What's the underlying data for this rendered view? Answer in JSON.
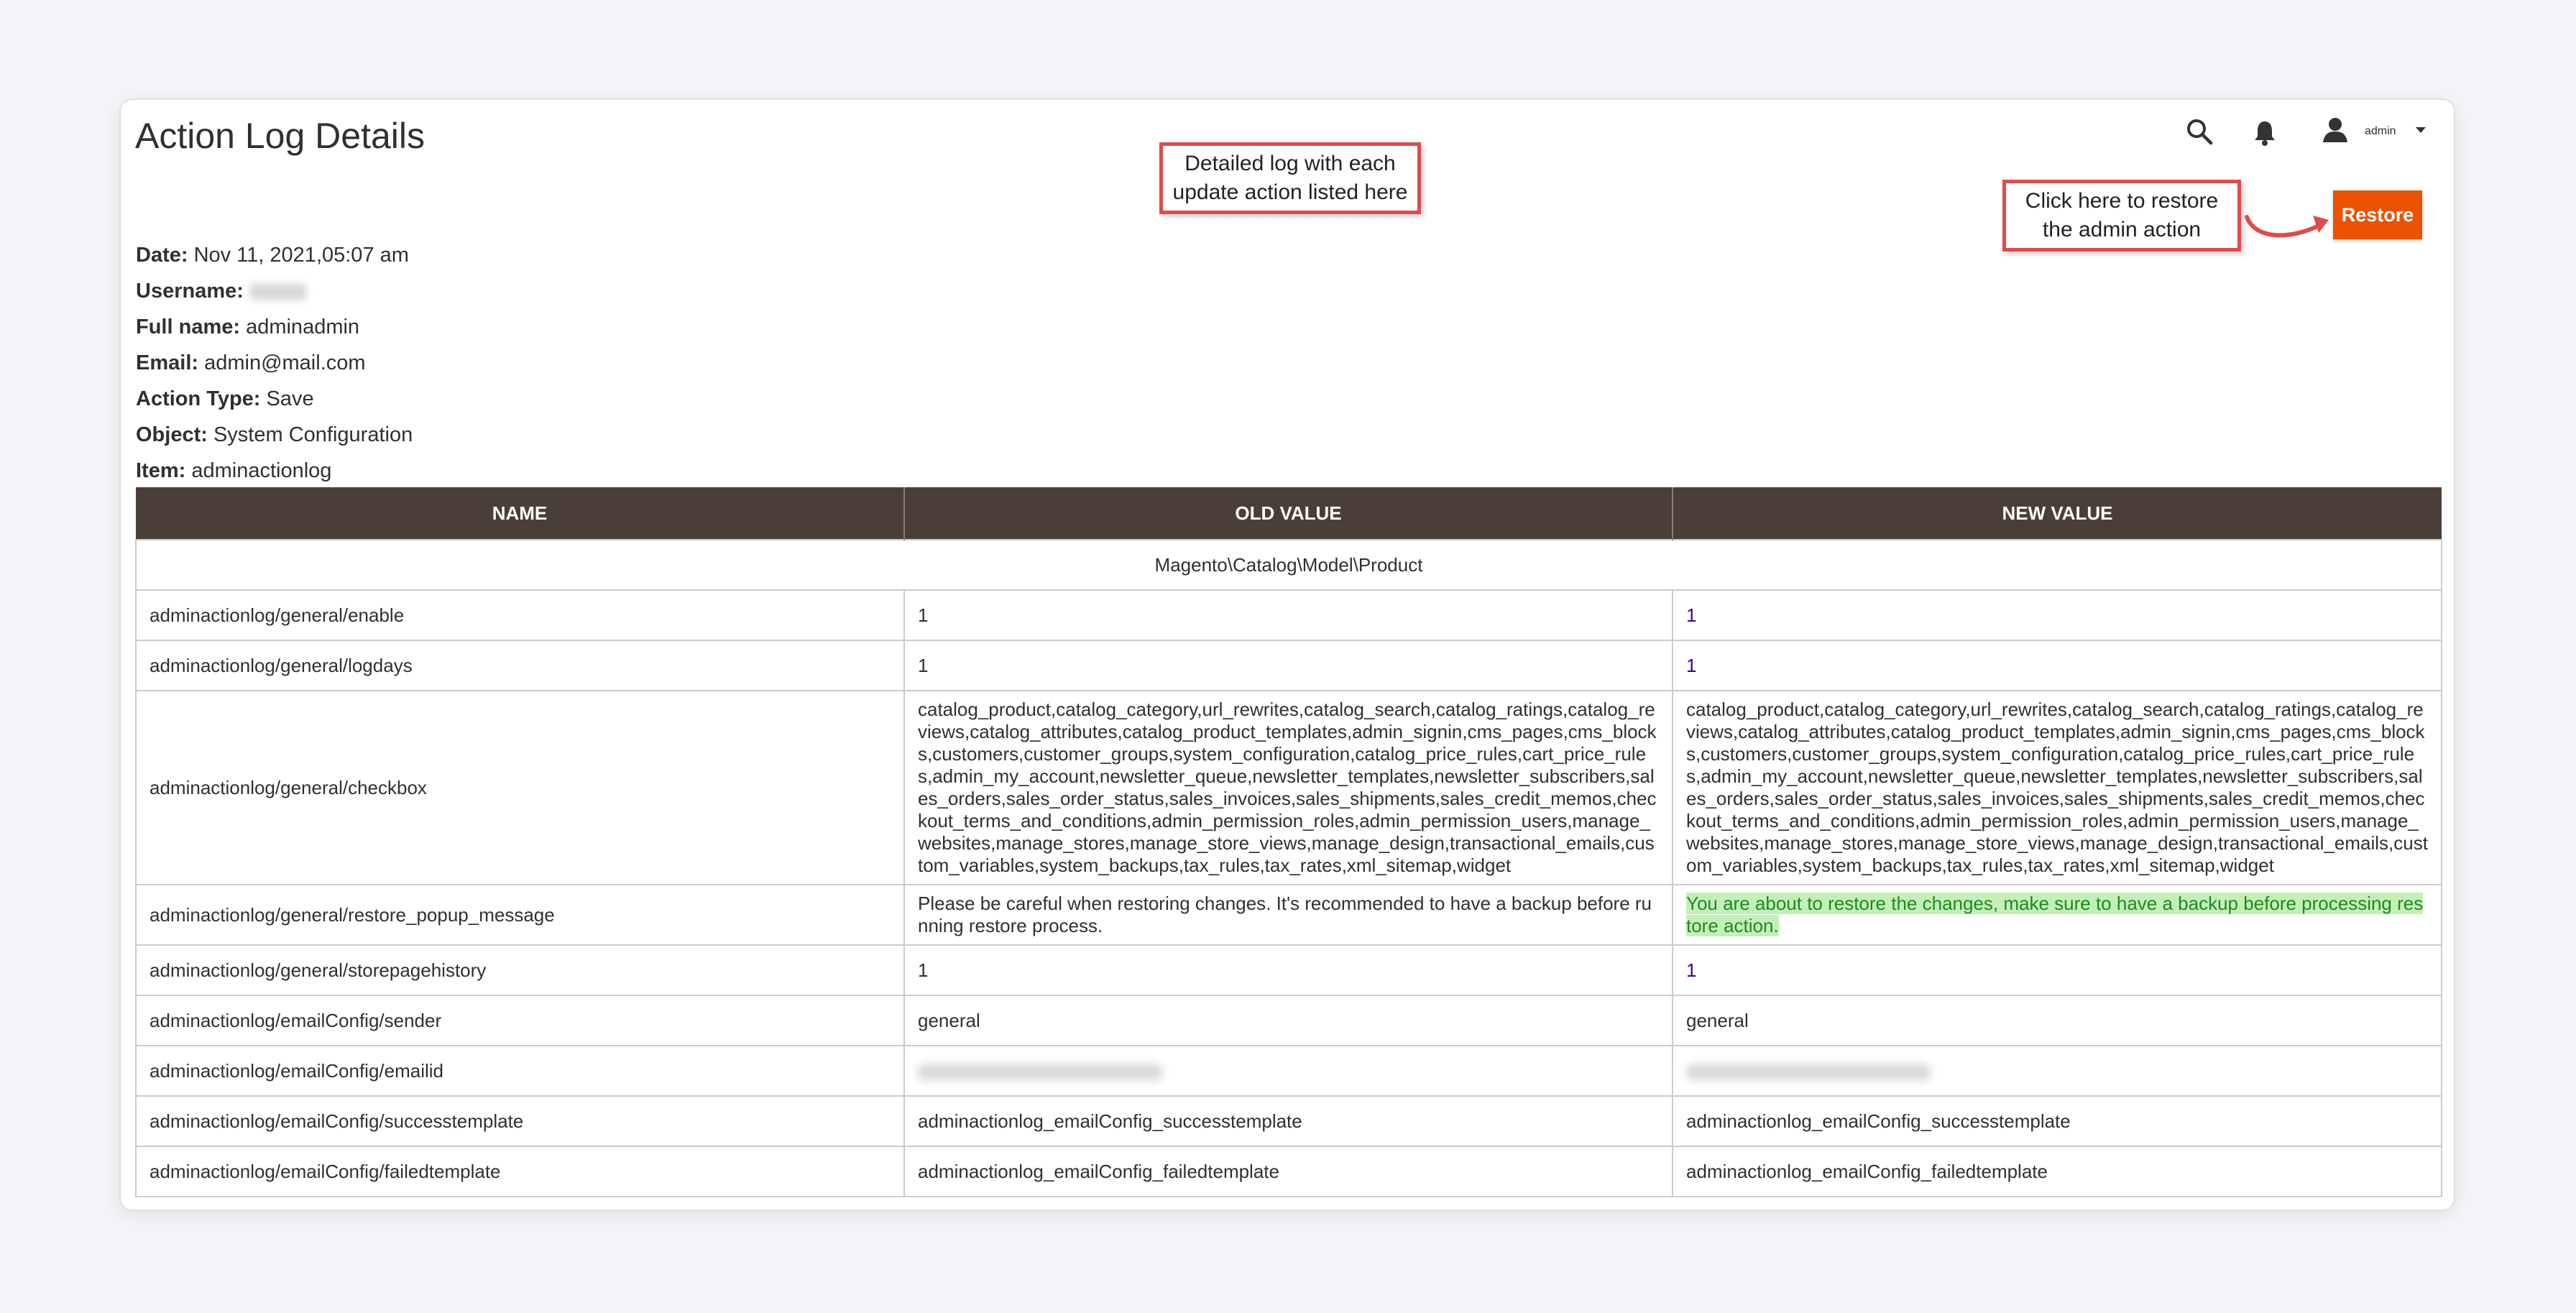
{
  "page": {
    "title": "Action Log Details"
  },
  "header": {
    "admin_label": "admin"
  },
  "annotations": {
    "log_callout": "Detailed log with each\nupdate action listed here",
    "restore_callout": "Click here to restore\nthe admin action"
  },
  "toolbar": {
    "restore_label": "Restore"
  },
  "details": {
    "date_label": "Date:",
    "date_value": "Nov 11, 2021,05:07 am",
    "username_label": "Username:",
    "fullname_label": "Full name:",
    "fullname_value": "adminadmin",
    "email_label": "Email:",
    "email_value": "admin@mail.com",
    "action_type_label": "Action Type:",
    "action_type_value": "Save",
    "object_label": "Object:",
    "object_value": "System Configuration",
    "item_label": "Item:",
    "item_value": "adminactionlog"
  },
  "table": {
    "headers": [
      "NAME",
      "OLD VALUE",
      "NEW VALUE"
    ],
    "section": "Magento\\Catalog\\Model\\Product",
    "rows": [
      {
        "name": "adminactionlog/general/enable",
        "old": "1",
        "new": "1"
      },
      {
        "name": "adminactionlog/general/logdays",
        "old": "1",
        "new": "1"
      },
      {
        "name": "adminactionlog/general/checkbox",
        "old": "catalog_product,catalog_category,url_rewrites,catalog_search,catalog_ratings,catalog_reviews,catalog_attributes,catalog_product_templates,admin_signin,cms_pages,cms_blocks,customers,customer_groups,system_configuration,catalog_price_rules,cart_price_rules,admin_my_account,newsletter_queue,newsletter_templates,newsletter_subscribers,sales_orders,sales_order_status,sales_invoices,sales_shipments,sales_credit_memos,checkout_terms_and_conditions,admin_permission_roles,admin_permission_users,manage_websites,manage_stores,manage_store_views,manage_design,transactional_emails,custom_variables,system_backups,tax_rules,tax_rates,xml_sitemap,widget",
        "new": "catalog_product,catalog_category,url_rewrites,catalog_search,catalog_ratings,catalog_reviews,catalog_attributes,catalog_product_templates,admin_signin,cms_pages,cms_blocks,customers,customer_groups,system_configuration,catalog_price_rules,cart_price_rules,admin_my_account,newsletter_queue,newsletter_templates,newsletter_subscribers,sales_orders,sales_order_status,sales_invoices,sales_shipments,sales_credit_memos,checkout_terms_and_conditions,admin_permission_roles,admin_permission_users,manage_websites,manage_stores,manage_store_views,manage_design,transactional_emails,custom_variables,system_backups,tax_rules,tax_rates,xml_sitemap,widget"
      },
      {
        "name": "adminactionlog/general/restore_popup_message",
        "old": "Please be careful when restoring changes. It's recommended to have a backup before running restore process.",
        "new": "You are about to restore the changes, make sure to have a backup before processing restore action."
      },
      {
        "name": "adminactionlog/general/storepagehistory",
        "old": "1",
        "new": "1"
      },
      {
        "name": "adminactionlog/emailConfig/sender",
        "old": "general",
        "new": "general"
      },
      {
        "name": "adminactionlog/emailConfig/emailid",
        "old": "",
        "new": ""
      },
      {
        "name": "adminactionlog/emailConfig/successtemplate",
        "old": "adminactionlog_emailConfig_successtemplate",
        "new": "adminactionlog_emailConfig_successtemplate"
      },
      {
        "name": "adminactionlog/emailConfig/failedtemplate",
        "old": "adminactionlog_emailConfig_failedtemplate",
        "new": "adminactionlog_emailConfig_failedtemplate"
      }
    ]
  },
  "colors": {
    "accent": "#eb5202",
    "header_bg": "#4a3f38",
    "callout_border": "#e04a4a",
    "highlight_bg": "#c3f0b8"
  },
  "icons": [
    "search-icon",
    "bell-icon",
    "user-icon",
    "chevron-down-icon",
    "arrow-icon"
  ]
}
